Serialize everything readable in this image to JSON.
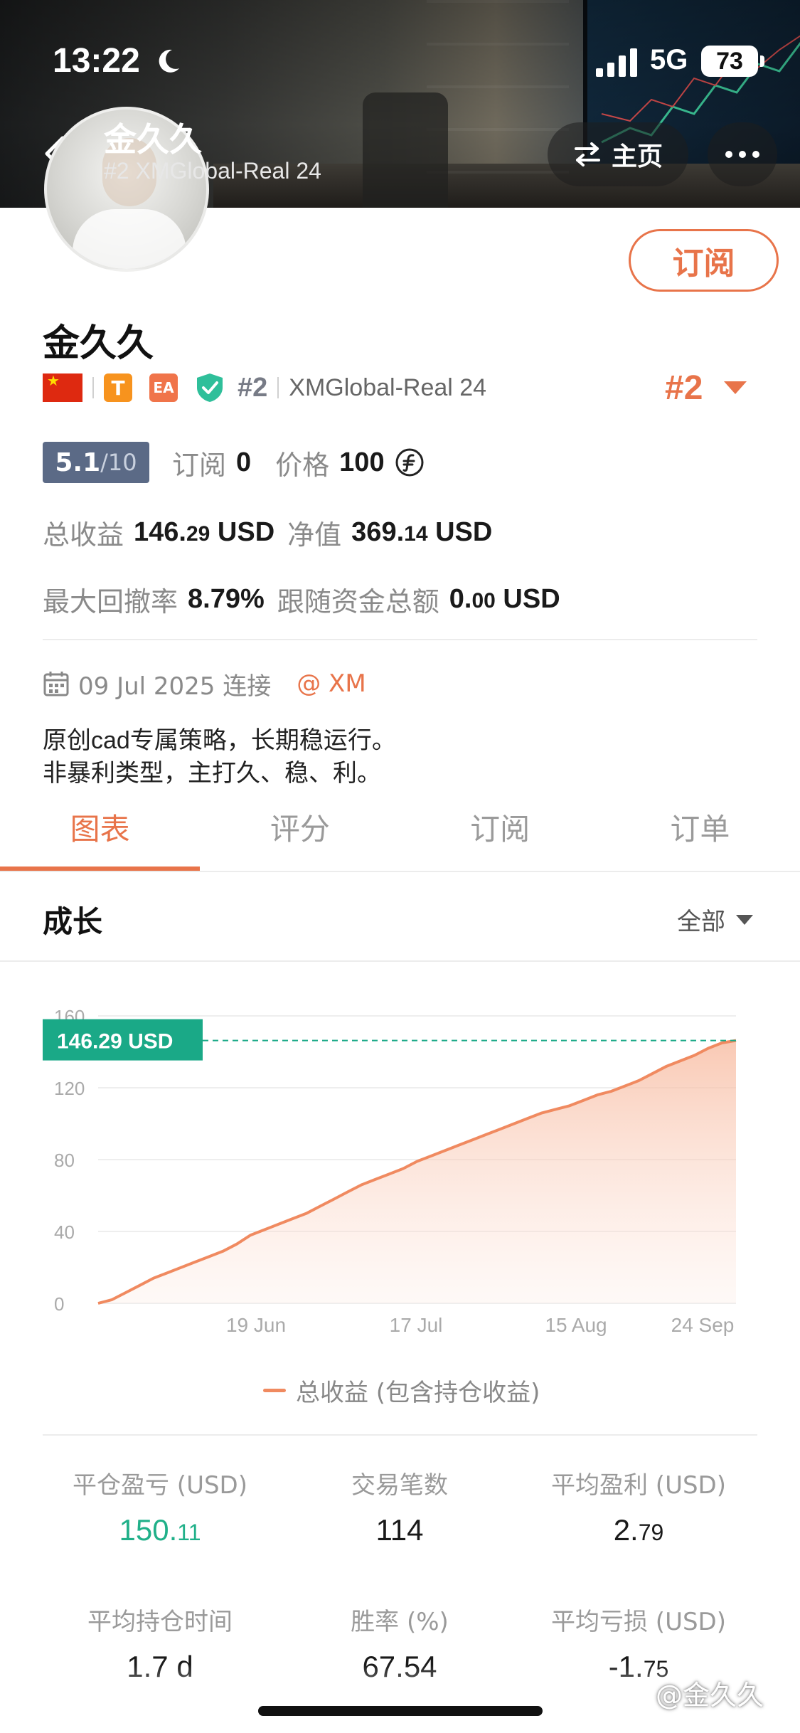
{
  "status_bar": {
    "time": "13:22",
    "network": "5G",
    "battery": "73"
  },
  "header": {
    "name": "金久久",
    "subtitle": "#2 XMGlobal-Real 24",
    "home_label": "主页"
  },
  "profile": {
    "subscribe_label": "订阅",
    "name": "金久久",
    "tag_t": "T",
    "tag_ea": "EA",
    "rank": "#2",
    "server": "XMGlobal-Real 24",
    "rank_right": "#2",
    "score": "5.1",
    "score_max": "/10",
    "subscribe_count_label": "订阅",
    "subscribe_count": "0",
    "price_label": "价格",
    "price": "100",
    "total_profit_label": "总收益",
    "total_profit_int": "146.",
    "total_profit_dec": "29",
    "total_profit_unit": "USD",
    "equity_label": "净值",
    "equity_int": "369.",
    "equity_dec": "14",
    "equity_unit": "USD",
    "max_drawdown_label": "最大回撤率",
    "max_drawdown": "8.79%",
    "follow_funds_label": "跟随资金总额",
    "follow_funds_int": "0.",
    "follow_funds_dec": "00",
    "follow_funds_unit": "USD",
    "connected_date": "09 Jul 2025 连接",
    "broker": "@ XM",
    "bio_line1": "原创cad专属策略，长期稳运行。",
    "bio_line2": "非暴利类型，主打久、稳、利。"
  },
  "tabs": [
    {
      "label": "图表",
      "active": true
    },
    {
      "label": "评分",
      "active": false
    },
    {
      "label": "订阅",
      "active": false
    },
    {
      "label": "订单",
      "active": false
    }
  ],
  "section": {
    "title": "成长",
    "range": "全部"
  },
  "chart_data": {
    "type": "area",
    "series": [
      {
        "name": "总收益 (包含持仓收益)",
        "color": "#f08a60"
      }
    ],
    "x_tick_labels": [
      "19 Jun",
      "17 Jul",
      "15 Aug",
      "24 Sep"
    ],
    "y_tick_labels": [
      "0",
      "40",
      "80",
      "120",
      "160"
    ],
    "ylim": [
      0,
      160
    ],
    "current_label": "146.29 USD",
    "current_value": 146.29,
    "values": [
      0,
      2,
      6,
      10,
      14,
      17,
      20,
      23,
      26,
      29,
      33,
      38,
      41,
      44,
      47,
      50,
      54,
      58,
      62,
      66,
      69,
      72,
      75,
      79,
      82,
      85,
      88,
      91,
      94,
      97,
      100,
      103,
      106,
      108,
      110,
      113,
      116,
      118,
      121,
      124,
      128,
      132,
      135,
      138,
      142,
      145,
      146.29
    ],
    "grid": true,
    "legend_position": "bottom"
  },
  "legend_label": "总收益 (包含持仓收益)",
  "stats": {
    "closed_pl_label": "平仓盈亏 (USD)",
    "closed_pl_int": "150.",
    "closed_pl_dec": "11",
    "trades_label": "交易笔数",
    "trades": "114",
    "avg_profit_label": "平均盈利 (USD)",
    "avg_profit_int": "2.",
    "avg_profit_dec": "79",
    "avg_hold_label": "平均持仓时间",
    "avg_hold": "1.7 d",
    "win_rate_label": "胜率 (%)",
    "win_rate": "67.54",
    "avg_loss_label": "平均亏损 (USD)",
    "avg_loss_int": "-1.",
    "avg_loss_dec": "75"
  },
  "watermark": "@金久久",
  "colors": {
    "accent": "#e8744a",
    "profit_green": "#20b089",
    "teal_label": "#1aa987"
  }
}
